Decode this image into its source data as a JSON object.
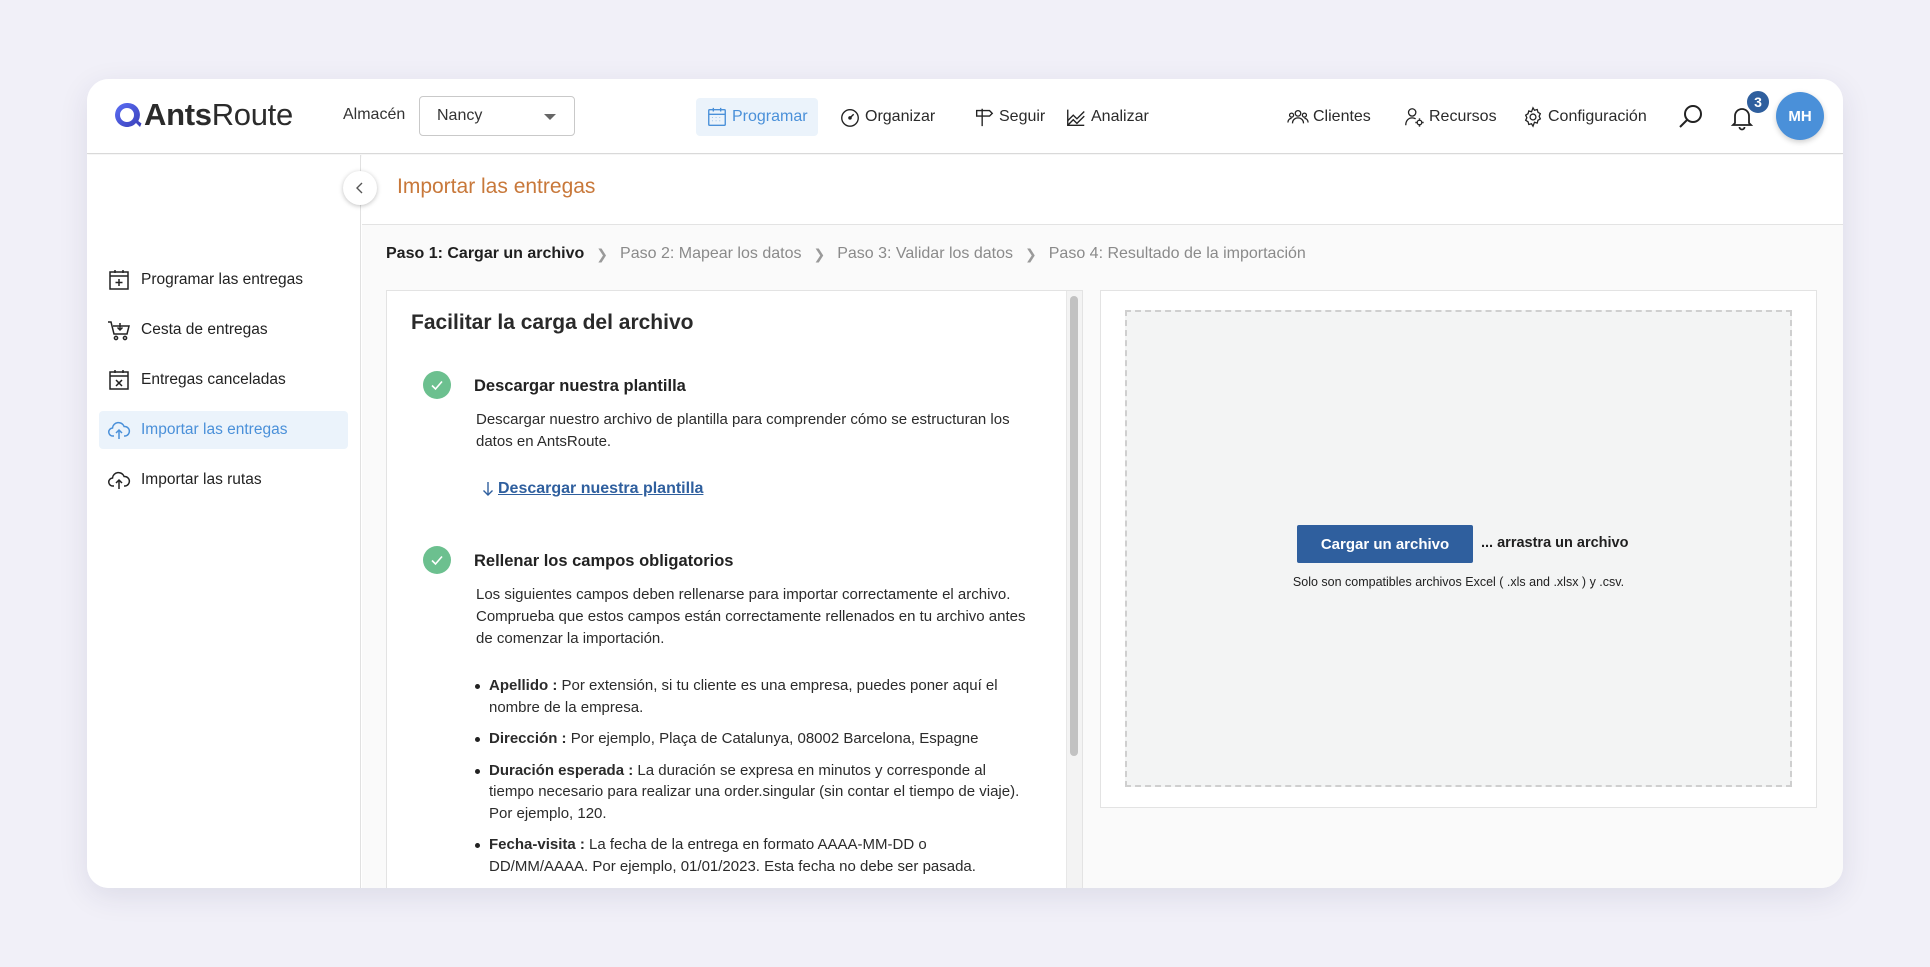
{
  "brand": {
    "name_part1": "Ants",
    "name_part2": "Route"
  },
  "header": {
    "warehouse_label": "Almacén",
    "warehouse_value": "Nancy",
    "nav": [
      {
        "label": "Programar",
        "icon": "calendar-icon",
        "active": true
      },
      {
        "label": "Organizar",
        "icon": "speedometer-icon",
        "active": false
      },
      {
        "label": "Seguir",
        "icon": "signpost-icon",
        "active": false
      },
      {
        "label": "Analizar",
        "icon": "chart-icon",
        "active": false
      }
    ],
    "right_nav": [
      {
        "label": "Clientes",
        "icon": "clients-icon"
      },
      {
        "label": "Recursos",
        "icon": "resources-icon"
      },
      {
        "label": "Configuración",
        "icon": "gear-icon"
      }
    ],
    "notifications_count": "3",
    "avatar_initials": "MH"
  },
  "sidebar": {
    "items": [
      {
        "label": "Programar las entregas",
        "icon": "calendar-plus-icon",
        "active": false
      },
      {
        "label": "Cesta de entregas",
        "icon": "cart-icon",
        "active": false
      },
      {
        "label": "Entregas canceladas",
        "icon": "calendar-x-icon",
        "active": false
      },
      {
        "label": "Importar las entregas",
        "icon": "cloud-upload-icon",
        "active": true
      },
      {
        "label": "Importar las rutas",
        "icon": "cloud-upload-icon",
        "active": false
      }
    ]
  },
  "page": {
    "title": "Importar las entregas",
    "steps": [
      "Paso 1: Cargar un archivo",
      "Paso 2: Mapear los datos",
      "Paso 3: Validar los datos",
      "Paso 4: Resultado de la importación"
    ]
  },
  "guide": {
    "title": "Facilitar la carga del archivo",
    "section1": {
      "title": "Descargar nuestra plantilla",
      "text": "Descargar nuestro archivo de plantilla para comprender cómo se estructuran los datos en AntsRoute.",
      "link": "Descargar nuestra plantilla"
    },
    "section2": {
      "title": "Rellenar los campos obligatorios",
      "text": "Los siguientes campos deben rellenarse para importar correctamente el archivo. Comprueba que estos campos están correctamente rellenados en tu archivo antes de comenzar la importación.",
      "fields": [
        {
          "name": "Apellido :",
          "desc": " Por extensión, si tu cliente es una empresa, puedes poner aquí el nombre de la empresa."
        },
        {
          "name": "Dirección :",
          "desc": " Por ejemplo, Plaça de Catalunya, 08002 Barcelona, Espagne"
        },
        {
          "name": "Duración esperada :",
          "desc": " La duración se expresa en minutos y corresponde al tiempo necesario para realizar una order.singular (sin contar el tiempo de viaje). Por ejemplo, 120."
        },
        {
          "name": "Fecha-visita :",
          "desc": " La fecha de la entrega en formato AAAA-MM-DD o DD/MM/AAAA. Por ejemplo, 01/01/2023. Esta fecha no debe ser pasada."
        }
      ]
    }
  },
  "upload": {
    "button": "Cargar un archivo",
    "drag_text": "... arrastra un archivo",
    "compat_text": "Solo son compatibles archivos Excel ( .xls and .xlsx ) y .csv."
  },
  "colors": {
    "accent": "#4a90d9",
    "primary_button": "#2f5f9e",
    "title_orange": "#c8783a",
    "check_green": "#6cc08f"
  }
}
